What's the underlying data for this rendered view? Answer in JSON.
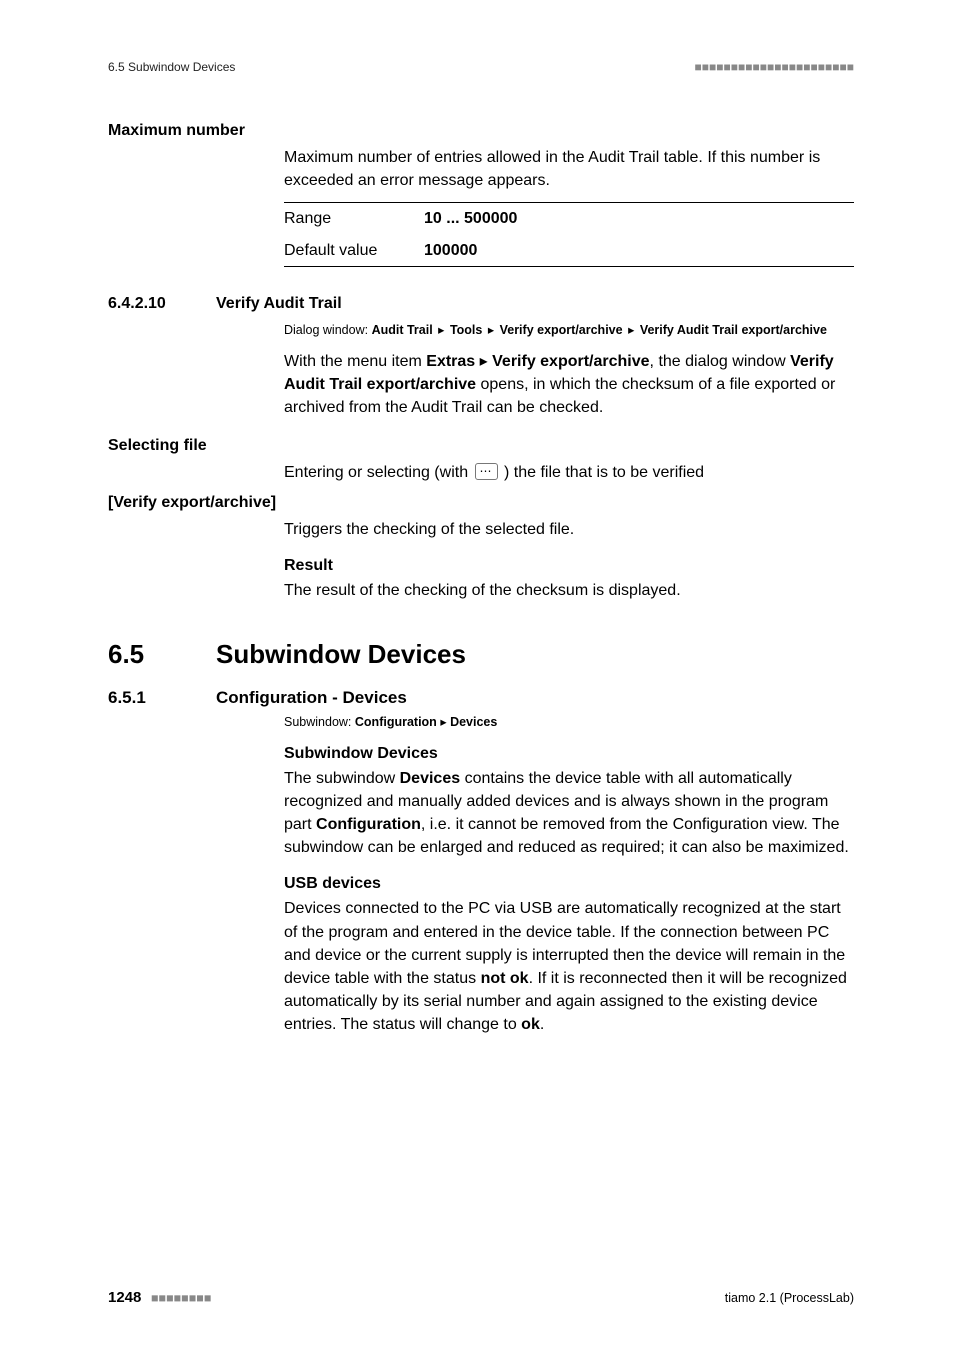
{
  "header": {
    "left": "6.5 Subwindow Devices",
    "right": "■■■■■■■■■■■■■■■■■■■■■■"
  },
  "max_number": {
    "title": "Maximum number",
    "desc": "Maximum number of entries allowed in the Audit Trail table. If this number is exceeded an error message appears.",
    "range_label": "Range",
    "range_value": "10 ... 500000",
    "default_label": "Default value",
    "default_value": "100000"
  },
  "section_6_4_2_10": {
    "num": "6.4.2.10",
    "title": "Verify Audit Trail",
    "path_prefix": "Dialog window:",
    "path_parts": [
      "Audit Trail",
      "Tools",
      "Verify export/archive",
      "Verify Audit Trail export/archive"
    ],
    "p_pre": "With the menu item ",
    "p_b1": "Extras",
    "p_mid1": " ▸ ",
    "p_b2": "Verify export/archive",
    "p_mid2": ", the dialog window ",
    "p_b3": "Verify Audit Trail export/archive",
    "p_post": " opens, in which the checksum of a file exported or archived from the Audit Trail can be checked."
  },
  "selecting_file": {
    "title": "Selecting file",
    "pre": "Entering or selecting (with ",
    "btn": "⋯",
    "post": " ) the file that is to be verified"
  },
  "verify_btn": {
    "title": "[Verify export/archive]",
    "desc": "Triggers the checking of the selected file."
  },
  "result": {
    "title": "Result",
    "desc": "The result of the checking of the checksum is displayed."
  },
  "section_6_5": {
    "num": "6.5",
    "title": "Subwindow Devices"
  },
  "section_6_5_1": {
    "num": "6.5.1",
    "title": "Configuration - Devices",
    "path_prefix": "Subwindow:",
    "path_parts": [
      "Configuration",
      "Devices"
    ]
  },
  "subwindow_devices": {
    "title": "Subwindow Devices",
    "p_pre": "The subwindow ",
    "p_b1": "Devices",
    "p_mid1": " contains the device table with all automatically recognized and manually added devices and is always shown in the program part ",
    "p_b2": "Configuration",
    "p_post": ", i.e. it cannot be removed from the Configuration view. The subwindow can be enlarged and reduced as required; it can also be maximized."
  },
  "usb": {
    "title": "USB devices",
    "p_pre": "Devices connected to the PC via USB are automatically recognized at the start of the program and entered in the device table. If the connection between PC and device or the current supply is interrupted then the device will remain in the device table with the status ",
    "p_b1": "not ok",
    "p_mid": ". If it is reconnected then it will be recognized automatically by its serial number and again assigned to the existing device entries. The status will change to ",
    "p_b2": "ok",
    "p_post": "."
  },
  "footer": {
    "page": "1248",
    "dots": "■■■■■■■■",
    "right": "tiamo 2.1 (ProcessLab)"
  },
  "tri": "▸"
}
